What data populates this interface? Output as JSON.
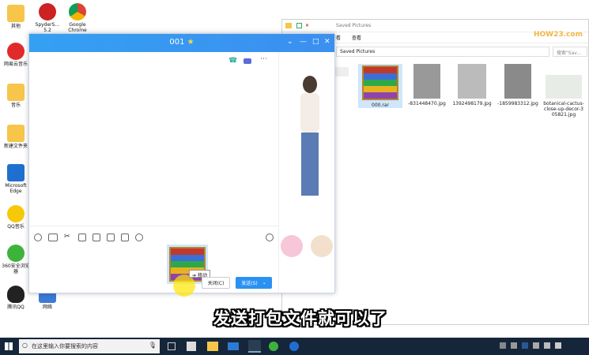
{
  "desktop": {
    "icons": [
      {
        "label": "其他"
      },
      {
        "label": "SpyderS… 5.2"
      },
      {
        "label": "Google Chrome"
      },
      {
        "label": "网易云音乐"
      },
      {
        "label": "音乐"
      },
      {
        "label": "新建文件夹"
      },
      {
        "label": "Microsoft Edge"
      },
      {
        "label": "QQ音乐"
      },
      {
        "label": "360安全浏览器"
      },
      {
        "label": "腾讯QQ"
      },
      {
        "label": "网络"
      }
    ]
  },
  "explorer": {
    "title": "Saved Pictures",
    "tabs": [
      "查看",
      "查看"
    ],
    "address": "Saved Pictures",
    "search_placeholder": "搜索\"Sav...",
    "files": [
      {
        "name": "000.rar"
      },
      {
        "name": "-831448470.jpg"
      },
      {
        "name": "1392498179.jpg"
      },
      {
        "name": "-1859983312.jpg"
      },
      {
        "name": "botanical-cactus-close-up-decor-305821.jpg"
      }
    ],
    "watermark": "HOW23.com"
  },
  "chat": {
    "title": "001",
    "drag_tooltip": "移动",
    "close_label": "关闭(C)",
    "send_label": "发送(S)"
  },
  "subtitle": "发送打包文件就可以了",
  "taskbar": {
    "search_placeholder": "在这里输入你要搜索的内容"
  }
}
